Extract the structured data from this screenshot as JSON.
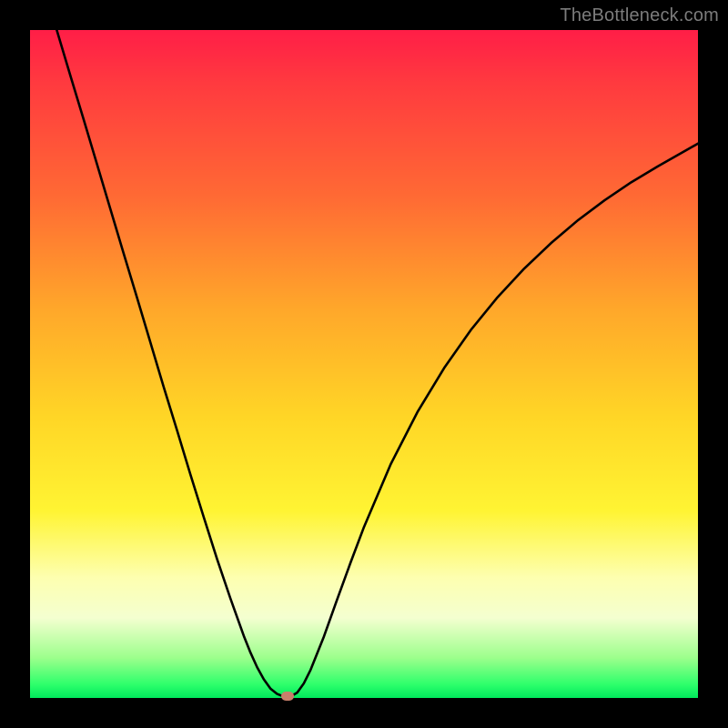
{
  "watermark": {
    "text": "TheBottleneck.com"
  },
  "colors": {
    "frame": "#000000",
    "curve": "#000000",
    "marker": "#c87f6b",
    "gradient_stops": [
      "#ff1e47",
      "#ff3a3f",
      "#ff6a34",
      "#ffa82a",
      "#ffd626",
      "#fff433",
      "#fdffb0",
      "#f4ffd0",
      "#9cff8c",
      "#2dff6b",
      "#00e85c"
    ]
  },
  "chart_data": {
    "type": "line",
    "title": "",
    "xlabel": "",
    "ylabel": "",
    "xlim": [
      0,
      100
    ],
    "ylim": [
      0,
      100
    ],
    "x": [
      4,
      6,
      8,
      10,
      12,
      14,
      16,
      18,
      20,
      22,
      24,
      26,
      28,
      30,
      32,
      33,
      34,
      35,
      36,
      37,
      38,
      39,
      40,
      41,
      42,
      44,
      46,
      48,
      50,
      54,
      58,
      62,
      66,
      70,
      74,
      78,
      82,
      86,
      90,
      94,
      100
    ],
    "values": [
      100,
      93.3,
      86.7,
      80.0,
      73.3,
      66.6,
      60.0,
      53.3,
      46.6,
      40.1,
      33.5,
      27.1,
      20.8,
      14.9,
      9.3,
      6.8,
      4.6,
      2.8,
      1.4,
      0.6,
      0.2,
      0.2,
      0.8,
      2.2,
      4.2,
      9.2,
      14.8,
      20.3,
      25.6,
      35.0,
      42.8,
      49.4,
      55.1,
      60.0,
      64.3,
      68.1,
      71.5,
      74.5,
      77.2,
      79.6,
      83.0
    ],
    "marker": {
      "x": 38.5,
      "y": 0.3
    },
    "grid": false,
    "legend": null
  }
}
